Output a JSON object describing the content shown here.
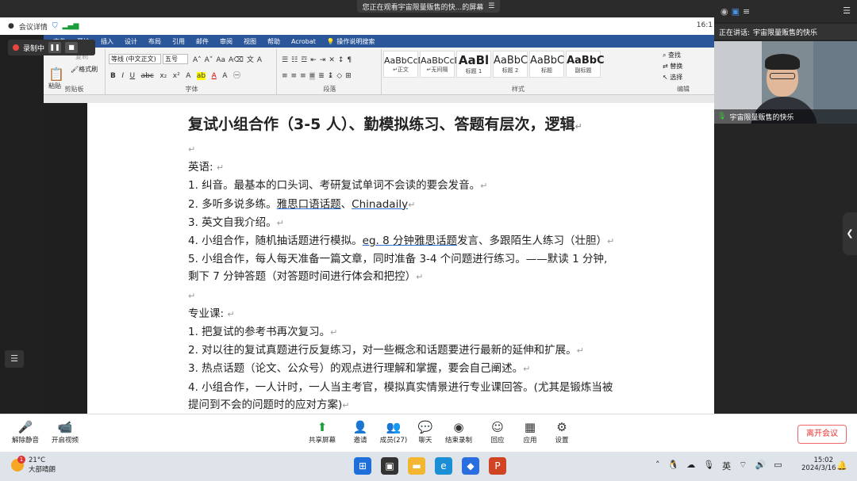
{
  "banner": {
    "text": "您正在观看宇宙限量贩售的快...的屏幕",
    "menu_icon": "hamburger-icon"
  },
  "meeting_bar": {
    "details": "会议详情",
    "time": "16:1"
  },
  "recording": {
    "label": "录制中"
  },
  "ribbon": {
    "tabs": [
      "文件",
      "开始",
      "插入",
      "设计",
      "布局",
      "引用",
      "邮件",
      "审阅",
      "视图",
      "帮助",
      "Acrobat",
      "操作说明搜索"
    ],
    "paste_label": "粘贴",
    "copy_label": "复制",
    "format_painter": "格式刷",
    "clipboard_caption": "剪贴板",
    "font_name": "等线 (中文正文)",
    "font_size": "五号",
    "font_caption": "字体",
    "paragraph_caption": "段落",
    "styles": [
      {
        "sample": "AaBbCcDd",
        "name": "↵正文"
      },
      {
        "sample": "AaBbCcDd",
        "name": "↵无间隔"
      },
      {
        "sample": "AaBl",
        "name": "标题 1"
      },
      {
        "sample": "AaBbC",
        "name": "标题 2"
      },
      {
        "sample": "AaBbC",
        "name": "标题"
      },
      {
        "sample": "AaBbC",
        "name": "副标题"
      }
    ],
    "styles_caption": "样式",
    "find": "查找",
    "replace": "替换",
    "select": "选择",
    "editing_caption": "编辑"
  },
  "document": {
    "title": "复试小组合作（3-5 人）、勤模拟练习、答题有层次，逻辑",
    "para_mark": "↵",
    "english_heading": "英语: ",
    "english": [
      "1. 纠音。最基本的口头词、考研复试单词不会读的要会发音。",
      "2. 多听多说多练。",
      "雅思口语话题",
      "、",
      "Chinadaily",
      "3. 英文自我介绍。",
      "4. 小组合作，随机抽话题进行模拟。",
      "eg. 8 分钟雅思话题",
      "发言、多跟陌生人练习（壮胆）",
      "5. 小组合作，每人每天准备一篇文章，同时准备 3-4 个问题进行练习。——默读 1 分钟,",
      "剩下 7 分钟答题（对答题时间进行体会和把控）"
    ],
    "major_heading": "专业课: ",
    "major": [
      "1. 把复试的参考书再次复习。",
      "2. 对以往的复试真题进行反复练习，对一些概念和话题要进行最新的延伸和扩展。",
      "3. 热点话题（论文、公众号）的观点进行理解和掌握，要会自己阐述。",
      "4. 小组合作，一人计时，一人当主考官，模拟真实情景进行专业课回答。(尤其是锻炼当被",
      "提问到不会的问题时的应对方案)"
    ]
  },
  "video": {
    "speaking_label": "正在讲话:",
    "speaker": "宇宙限量贩售的快乐",
    "participant_name": "宇宙限量贩售的快乐"
  },
  "toolbar": {
    "unmute": "解除静音",
    "video": "开启视频",
    "share": "共享屏幕",
    "invite": "邀请",
    "members": "成员(27)",
    "chat": "聊天",
    "stop_record": "结束录制",
    "reaction": "回应",
    "apps": "应用",
    "settings": "设置",
    "leave": "离开会议"
  },
  "taskbar": {
    "temp": "21°C",
    "weather": "大部晴朗",
    "badge": "1",
    "ime": "英",
    "time": "15:02",
    "date": "2024/3/16"
  },
  "colors": {
    "word_blue": "#2b579a",
    "leave_red": "#e33333",
    "record_red": "#e8463e"
  }
}
